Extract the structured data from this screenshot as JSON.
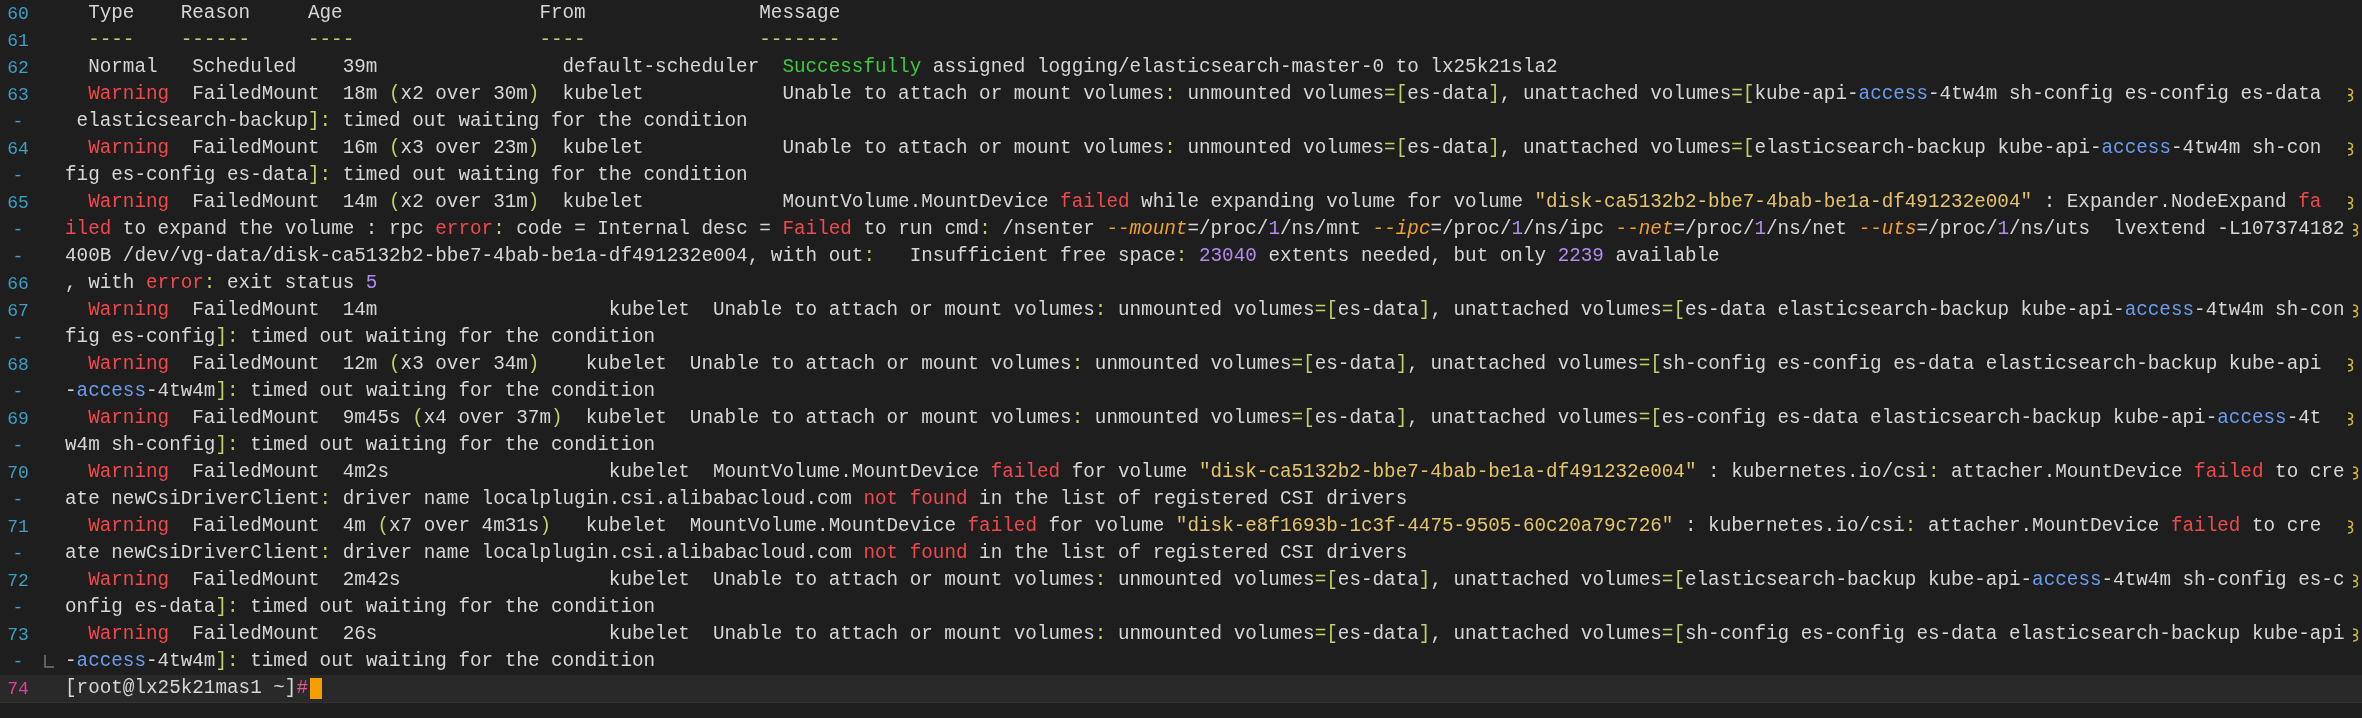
{
  "rows": [
    {
      "gutter": "60",
      "current": false,
      "wraps": false,
      "corner": false,
      "segments": [
        {
          "t": "  Type    Reason     Age                 From               Message",
          "kind": "text"
        }
      ]
    },
    {
      "gutter": "61",
      "current": false,
      "wraps": false,
      "corner": false,
      "segments": [
        {
          "t": "  ----    ------     ----                ----               -------",
          "kind": "punct"
        }
      ]
    },
    {
      "gutter": "62",
      "current": false,
      "wraps": false,
      "corner": false,
      "segments": [
        {
          "t": "  Normal   Scheduled    39m                default-scheduler  ",
          "kind": "text"
        },
        {
          "t": "Successfully",
          "kind": "ok"
        },
        {
          "t": " assigned logging/elasticsearch-master-0 to lx25k21sla2",
          "kind": "text"
        }
      ]
    },
    {
      "gutter": "63",
      "current": false,
      "wraps": true,
      "corner": false,
      "segments": [
        {
          "t": "  Warning",
          "kind": "alert"
        },
        {
          "t": "  FailedMount  18m ",
          "kind": "text"
        },
        {
          "t": "(",
          "kind": "punct"
        },
        {
          "t": "x2 over 30m",
          "kind": "text"
        },
        {
          "t": ")",
          "kind": "punct"
        },
        {
          "t": "  kubelet            Unable to attach or mount volumes",
          "kind": "text"
        },
        {
          "t": ":",
          "kind": "punct"
        },
        {
          "t": " unmounted volumes",
          "kind": "text"
        },
        {
          "t": "=[",
          "kind": "punct"
        },
        {
          "t": "es-data",
          "kind": "text"
        },
        {
          "t": "]",
          "kind": "punct"
        },
        {
          "t": ", unattached volumes",
          "kind": "text"
        },
        {
          "t": "=[",
          "kind": "punct"
        },
        {
          "t": "kube-api-",
          "kind": "text"
        },
        {
          "t": "access",
          "kind": "key"
        },
        {
          "t": "-4tw4m sh-config es-config es-data",
          "kind": "text"
        }
      ]
    },
    {
      "gutter": "-",
      "current": false,
      "wraps": false,
      "corner": false,
      "segments": [
        {
          "t": " elasticsearch-backup",
          "kind": "text"
        },
        {
          "t": "]:",
          "kind": "punct"
        },
        {
          "t": " timed out waiting for the condition",
          "kind": "text"
        }
      ]
    },
    {
      "gutter": "64",
      "current": false,
      "wraps": true,
      "corner": false,
      "segments": [
        {
          "t": "  Warning",
          "kind": "alert"
        },
        {
          "t": "  FailedMount  16m ",
          "kind": "text"
        },
        {
          "t": "(",
          "kind": "punct"
        },
        {
          "t": "x3 over 23m",
          "kind": "text"
        },
        {
          "t": ")",
          "kind": "punct"
        },
        {
          "t": "  kubelet            Unable to attach or mount volumes",
          "kind": "text"
        },
        {
          "t": ":",
          "kind": "punct"
        },
        {
          "t": " unmounted volumes",
          "kind": "text"
        },
        {
          "t": "=[",
          "kind": "punct"
        },
        {
          "t": "es-data",
          "kind": "text"
        },
        {
          "t": "]",
          "kind": "punct"
        },
        {
          "t": ", unattached volumes",
          "kind": "text"
        },
        {
          "t": "=[",
          "kind": "punct"
        },
        {
          "t": "elasticsearch-backup kube-api-",
          "kind": "text"
        },
        {
          "t": "access",
          "kind": "key"
        },
        {
          "t": "-4tw4m sh-con",
          "kind": "text"
        }
      ]
    },
    {
      "gutter": "-",
      "current": false,
      "wraps": false,
      "corner": false,
      "segments": [
        {
          "t": "fig es-config es-data",
          "kind": "text"
        },
        {
          "t": "]:",
          "kind": "punct"
        },
        {
          "t": " timed out waiting for the condition",
          "kind": "text"
        }
      ]
    },
    {
      "gutter": "65",
      "current": false,
      "wraps": true,
      "corner": false,
      "segments": [
        {
          "t": "  Warning",
          "kind": "alert"
        },
        {
          "t": "  FailedMount  14m ",
          "kind": "text"
        },
        {
          "t": "(",
          "kind": "punct"
        },
        {
          "t": "x2 over 31m",
          "kind": "text"
        },
        {
          "t": ")",
          "kind": "punct"
        },
        {
          "t": "  kubelet            MountVolume.MountDevice ",
          "kind": "text"
        },
        {
          "t": "failed",
          "kind": "alert"
        },
        {
          "t": " while expanding volume for volume ",
          "kind": "text"
        },
        {
          "t": "\"disk-ca5132b2-bbe7-4bab-be1a-df491232e004\"",
          "kind": "str"
        },
        {
          "t": " : Expander.NodeExpand ",
          "kind": "text"
        },
        {
          "t": "fa",
          "kind": "alert"
        }
      ]
    },
    {
      "gutter": "-",
      "current": false,
      "wraps": true,
      "corner": false,
      "segments": [
        {
          "t": "iled",
          "kind": "alert"
        },
        {
          "t": " to expand the volume : rpc ",
          "kind": "text"
        },
        {
          "t": "error",
          "kind": "alert"
        },
        {
          "t": ":",
          "kind": "punct"
        },
        {
          "t": " code = Internal desc = ",
          "kind": "text"
        },
        {
          "t": "Failed",
          "kind": "alert"
        },
        {
          "t": " to run cmd",
          "kind": "text"
        },
        {
          "t": ":",
          "kind": "punct"
        },
        {
          "t": " /nsenter ",
          "kind": "text"
        },
        {
          "t": "--mount",
          "kind": "flag"
        },
        {
          "t": "=/proc/",
          "kind": "text"
        },
        {
          "t": "1",
          "kind": "num"
        },
        {
          "t": "/ns/mnt ",
          "kind": "text"
        },
        {
          "t": "--ipc",
          "kind": "flag"
        },
        {
          "t": "=/proc/",
          "kind": "text"
        },
        {
          "t": "1",
          "kind": "num"
        },
        {
          "t": "/ns/ipc ",
          "kind": "text"
        },
        {
          "t": "--net",
          "kind": "flag"
        },
        {
          "t": "=/proc/",
          "kind": "text"
        },
        {
          "t": "1",
          "kind": "num"
        },
        {
          "t": "/ns/net ",
          "kind": "text"
        },
        {
          "t": "--uts",
          "kind": "flag"
        },
        {
          "t": "=/proc/",
          "kind": "text"
        },
        {
          "t": "1",
          "kind": "num"
        },
        {
          "t": "/ns/uts  lvextend -L107374182",
          "kind": "text"
        }
      ]
    },
    {
      "gutter": "-",
      "current": false,
      "wraps": false,
      "corner": false,
      "segments": [
        {
          "t": "400B /dev/vg-data/disk-ca5132b2-bbe7-4bab-be1a-df491232e004, with out",
          "kind": "text"
        },
        {
          "t": ":",
          "kind": "punct"
        },
        {
          "t": "   Insufficient free space",
          "kind": "text"
        },
        {
          "t": ":",
          "kind": "punct"
        },
        {
          "t": " 23040",
          "kind": "num"
        },
        {
          "t": " extents needed, but only ",
          "kind": "text"
        },
        {
          "t": "2239",
          "kind": "num"
        },
        {
          "t": " available",
          "kind": "text"
        }
      ]
    },
    {
      "gutter": "66",
      "current": false,
      "wraps": false,
      "corner": false,
      "segments": [
        {
          "t": ", with ",
          "kind": "text"
        },
        {
          "t": "error",
          "kind": "alert"
        },
        {
          "t": ":",
          "kind": "punct"
        },
        {
          "t": " exit status ",
          "kind": "text"
        },
        {
          "t": "5",
          "kind": "num"
        }
      ]
    },
    {
      "gutter": "67",
      "current": false,
      "wraps": true,
      "corner": false,
      "segments": [
        {
          "t": "  Warning",
          "kind": "alert"
        },
        {
          "t": "  FailedMount  14m                    kubelet  Unable to attach or mount volumes",
          "kind": "text"
        },
        {
          "t": ":",
          "kind": "punct"
        },
        {
          "t": " unmounted volumes",
          "kind": "text"
        },
        {
          "t": "=[",
          "kind": "punct"
        },
        {
          "t": "es-data",
          "kind": "text"
        },
        {
          "t": "]",
          "kind": "punct"
        },
        {
          "t": ", unattached volumes",
          "kind": "text"
        },
        {
          "t": "=[",
          "kind": "punct"
        },
        {
          "t": "es-data elasticsearch-backup kube-api-",
          "kind": "text"
        },
        {
          "t": "access",
          "kind": "key"
        },
        {
          "t": "-4tw4m sh-con",
          "kind": "text"
        }
      ]
    },
    {
      "gutter": "-",
      "current": false,
      "wraps": false,
      "corner": false,
      "segments": [
        {
          "t": "fig es-config",
          "kind": "text"
        },
        {
          "t": "]:",
          "kind": "punct"
        },
        {
          "t": " timed out waiting for the condition",
          "kind": "text"
        }
      ]
    },
    {
      "gutter": "68",
      "current": false,
      "wraps": true,
      "corner": false,
      "segments": [
        {
          "t": "  Warning",
          "kind": "alert"
        },
        {
          "t": "  FailedMount  12m ",
          "kind": "text"
        },
        {
          "t": "(",
          "kind": "punct"
        },
        {
          "t": "x3 over 34m",
          "kind": "text"
        },
        {
          "t": ")",
          "kind": "punct"
        },
        {
          "t": "    kubelet  Unable to attach or mount volumes",
          "kind": "text"
        },
        {
          "t": ":",
          "kind": "punct"
        },
        {
          "t": " unmounted volumes",
          "kind": "text"
        },
        {
          "t": "=[",
          "kind": "punct"
        },
        {
          "t": "es-data",
          "kind": "text"
        },
        {
          "t": "]",
          "kind": "punct"
        },
        {
          "t": ", unattached volumes",
          "kind": "text"
        },
        {
          "t": "=[",
          "kind": "punct"
        },
        {
          "t": "sh-config es-config es-data elasticsearch-backup kube-api",
          "kind": "text"
        }
      ]
    },
    {
      "gutter": "-",
      "current": false,
      "wraps": false,
      "corner": false,
      "segments": [
        {
          "t": "-",
          "kind": "text"
        },
        {
          "t": "access",
          "kind": "key"
        },
        {
          "t": "-4tw4m",
          "kind": "text"
        },
        {
          "t": "]:",
          "kind": "punct"
        },
        {
          "t": " timed out waiting for the condition",
          "kind": "text"
        }
      ]
    },
    {
      "gutter": "69",
      "current": false,
      "wraps": true,
      "corner": false,
      "segments": [
        {
          "t": "  Warning",
          "kind": "alert"
        },
        {
          "t": "  FailedMount  9m45s ",
          "kind": "text"
        },
        {
          "t": "(",
          "kind": "punct"
        },
        {
          "t": "x4 over 37m",
          "kind": "text"
        },
        {
          "t": ")",
          "kind": "punct"
        },
        {
          "t": "  kubelet  Unable to attach or mount volumes",
          "kind": "text"
        },
        {
          "t": ":",
          "kind": "punct"
        },
        {
          "t": " unmounted volumes",
          "kind": "text"
        },
        {
          "t": "=[",
          "kind": "punct"
        },
        {
          "t": "es-data",
          "kind": "text"
        },
        {
          "t": "]",
          "kind": "punct"
        },
        {
          "t": ", unattached volumes",
          "kind": "text"
        },
        {
          "t": "=[",
          "kind": "punct"
        },
        {
          "t": "es-config es-data elasticsearch-backup kube-api-",
          "kind": "text"
        },
        {
          "t": "access",
          "kind": "key"
        },
        {
          "t": "-4t",
          "kind": "text"
        }
      ]
    },
    {
      "gutter": "-",
      "current": false,
      "wraps": false,
      "corner": false,
      "segments": [
        {
          "t": "w4m sh-config",
          "kind": "text"
        },
        {
          "t": "]:",
          "kind": "punct"
        },
        {
          "t": " timed out waiting for the condition",
          "kind": "text"
        }
      ]
    },
    {
      "gutter": "70",
      "current": false,
      "wraps": true,
      "corner": false,
      "segments": [
        {
          "t": "  Warning",
          "kind": "alert"
        },
        {
          "t": "  FailedMount  4m2s                   kubelet  MountVolume.MountDevice ",
          "kind": "text"
        },
        {
          "t": "failed",
          "kind": "alert"
        },
        {
          "t": " for volume ",
          "kind": "text"
        },
        {
          "t": "\"disk-ca5132b2-bbe7-4bab-be1a-df491232e004\"",
          "kind": "str"
        },
        {
          "t": " : kubernetes.io/csi",
          "kind": "text"
        },
        {
          "t": ":",
          "kind": "punct"
        },
        {
          "t": " attacher.MountDevice ",
          "kind": "text"
        },
        {
          "t": "failed",
          "kind": "alert"
        },
        {
          "t": " to cre",
          "kind": "text"
        }
      ]
    },
    {
      "gutter": "-",
      "current": false,
      "wraps": false,
      "corner": false,
      "segments": [
        {
          "t": "ate newCsiDriverClient",
          "kind": "text"
        },
        {
          "t": ":",
          "kind": "punct"
        },
        {
          "t": " driver name localplugin.csi.alibabacloud.com ",
          "kind": "text"
        },
        {
          "t": "not found",
          "kind": "alert"
        },
        {
          "t": " in the list of registered CSI drivers",
          "kind": "text"
        }
      ]
    },
    {
      "gutter": "71",
      "current": false,
      "wraps": true,
      "corner": false,
      "segments": [
        {
          "t": "  Warning",
          "kind": "alert"
        },
        {
          "t": "  FailedMount  4m ",
          "kind": "text"
        },
        {
          "t": "(",
          "kind": "punct"
        },
        {
          "t": "x7 over 4m31s",
          "kind": "text"
        },
        {
          "t": ")",
          "kind": "punct"
        },
        {
          "t": "   kubelet  MountVolume.MountDevice ",
          "kind": "text"
        },
        {
          "t": "failed",
          "kind": "alert"
        },
        {
          "t": " for volume ",
          "kind": "text"
        },
        {
          "t": "\"disk-e8f1693b-1c3f-4475-9505-60c20a79c726\"",
          "kind": "str"
        },
        {
          "t": " : kubernetes.io/csi",
          "kind": "text"
        },
        {
          "t": ":",
          "kind": "punct"
        },
        {
          "t": " attacher.MountDevice ",
          "kind": "text"
        },
        {
          "t": "failed",
          "kind": "alert"
        },
        {
          "t": " to cre",
          "kind": "text"
        }
      ]
    },
    {
      "gutter": "-",
      "current": false,
      "wraps": false,
      "corner": false,
      "segments": [
        {
          "t": "ate newCsiDriverClient",
          "kind": "text"
        },
        {
          "t": ":",
          "kind": "punct"
        },
        {
          "t": " driver name localplugin.csi.alibabacloud.com ",
          "kind": "text"
        },
        {
          "t": "not found",
          "kind": "alert"
        },
        {
          "t": " in the list of registered CSI drivers",
          "kind": "text"
        }
      ]
    },
    {
      "gutter": "72",
      "current": false,
      "wraps": true,
      "corner": false,
      "segments": [
        {
          "t": "  Warning",
          "kind": "alert"
        },
        {
          "t": "  FailedMount  2m42s                  kubelet  Unable to attach or mount volumes",
          "kind": "text"
        },
        {
          "t": ":",
          "kind": "punct"
        },
        {
          "t": " unmounted volumes",
          "kind": "text"
        },
        {
          "t": "=[",
          "kind": "punct"
        },
        {
          "t": "es-data",
          "kind": "text"
        },
        {
          "t": "]",
          "kind": "punct"
        },
        {
          "t": ", unattached volumes",
          "kind": "text"
        },
        {
          "t": "=[",
          "kind": "punct"
        },
        {
          "t": "elasticsearch-backup kube-api-",
          "kind": "text"
        },
        {
          "t": "access",
          "kind": "key"
        },
        {
          "t": "-4tw4m sh-config es-c",
          "kind": "text"
        }
      ]
    },
    {
      "gutter": "-",
      "current": false,
      "wraps": false,
      "corner": false,
      "segments": [
        {
          "t": "onfig es-data",
          "kind": "text"
        },
        {
          "t": "]:",
          "kind": "punct"
        },
        {
          "t": " timed out waiting for the condition",
          "kind": "text"
        }
      ]
    },
    {
      "gutter": "73",
      "current": false,
      "wraps": true,
      "corner": false,
      "segments": [
        {
          "t": "  Warning",
          "kind": "alert"
        },
        {
          "t": "  FailedMount  26s                    kubelet  Unable to attach or mount volumes",
          "kind": "text"
        },
        {
          "t": ":",
          "kind": "punct"
        },
        {
          "t": " unmounted volumes",
          "kind": "text"
        },
        {
          "t": "=[",
          "kind": "punct"
        },
        {
          "t": "es-data",
          "kind": "text"
        },
        {
          "t": "]",
          "kind": "punct"
        },
        {
          "t": ", unattached volumes",
          "kind": "text"
        },
        {
          "t": "=[",
          "kind": "punct"
        },
        {
          "t": "sh-config es-config es-data elasticsearch-backup kube-api",
          "kind": "text"
        }
      ]
    },
    {
      "gutter": "-",
      "current": false,
      "wraps": false,
      "corner": true,
      "segments": [
        {
          "t": "-",
          "kind": "text"
        },
        {
          "t": "access",
          "kind": "key"
        },
        {
          "t": "-4tw4m",
          "kind": "text"
        },
        {
          "t": "]:",
          "kind": "punct"
        },
        {
          "t": " timed out waiting for the condition",
          "kind": "text"
        }
      ]
    },
    {
      "gutter": "74",
      "current": true,
      "wraps": false,
      "corner": false,
      "segments": [
        {
          "t": "[root@lx25k21mas1 ~]",
          "kind": "text"
        },
        {
          "t": "#",
          "kind": "prompt"
        }
      ]
    }
  ]
}
